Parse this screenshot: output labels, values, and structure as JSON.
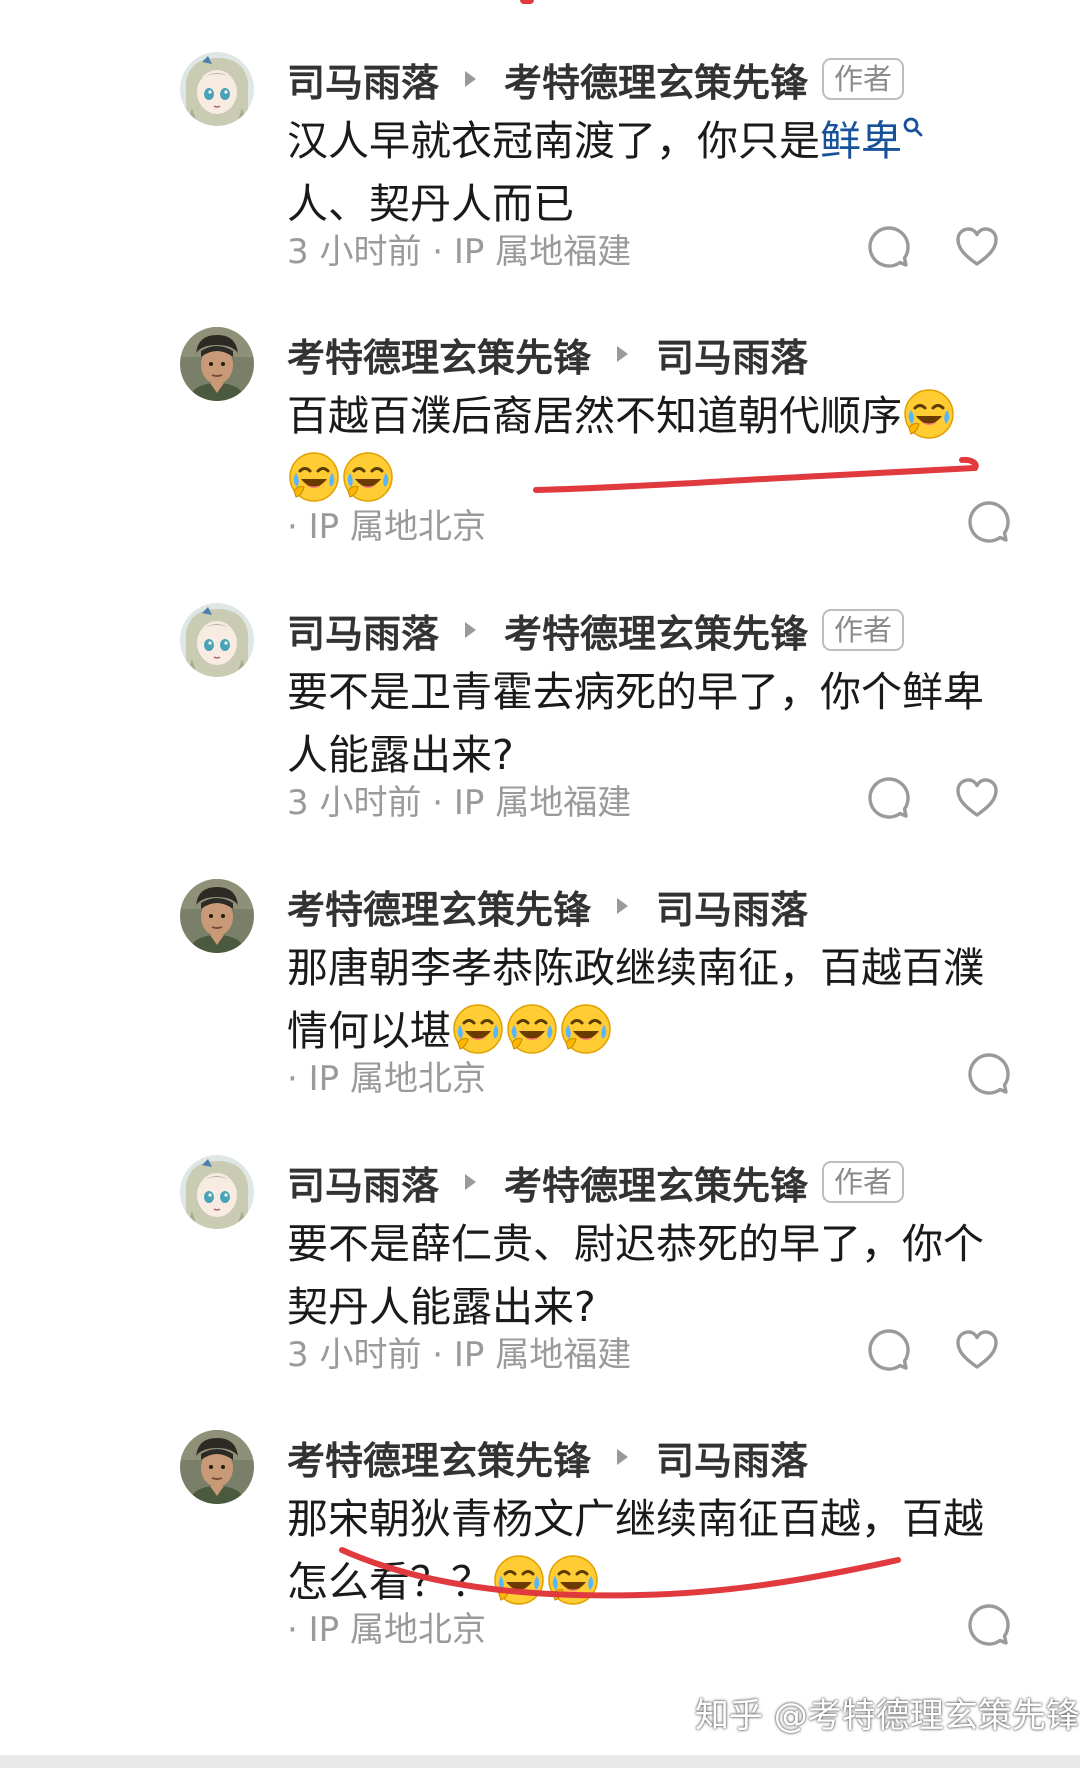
{
  "comments": [
    {
      "author": "司马雨落",
      "reply_to": "考特德理玄策先锋",
      "badge": "作者",
      "text_line1_a": "汉人早就衣冠南渡了，你只是",
      "text_link": "鲜卑",
      "text_line2": "人、契丹人而已",
      "meta": "3 小时前 · IP 属地福建"
    },
    {
      "author": "考特德理玄策先锋",
      "reply_to": "司马雨落",
      "text_line1": "百越百濮后裔居然不知道朝代顺序",
      "meta": "· IP 属地北京"
    },
    {
      "author": "司马雨落",
      "reply_to": "考特德理玄策先锋",
      "badge": "作者",
      "text_line1": "要不是卫青霍去病死的早了，你个鲜卑",
      "text_line2": "人能露出来?",
      "meta": "3 小时前 · IP 属地福建"
    },
    {
      "author": "考特德理玄策先锋",
      "reply_to": "司马雨落",
      "text_line1": "那唐朝李孝恭陈政继续南征，百越百濮",
      "text_line2": "情何以堪",
      "meta": "· IP 属地北京"
    },
    {
      "author": "司马雨落",
      "reply_to": "考特德理玄策先锋",
      "badge": "作者",
      "text_line1": "要不是薛仁贵、尉迟恭死的早了，你个",
      "text_line2": "契丹人能露出来?",
      "meta": "3 小时前 · IP 属地福建"
    },
    {
      "author": "考特德理玄策先锋",
      "reply_to": "司马雨落",
      "text_line1": "那宋朝狄青杨文广继续南征百越，百越",
      "text_line2": "怎么看？？",
      "meta": "· IP 属地北京"
    }
  ],
  "watermark": "知乎 @考特德理玄策先锋",
  "icons": {
    "reply": "speech-bubble-icon",
    "like": "heart-icon",
    "search": "search-icon",
    "emoji": "laughing-crying-emoji"
  },
  "colors": {
    "link": "#175199",
    "annotation": "#e0393e",
    "meta": "#9a9a9a"
  }
}
